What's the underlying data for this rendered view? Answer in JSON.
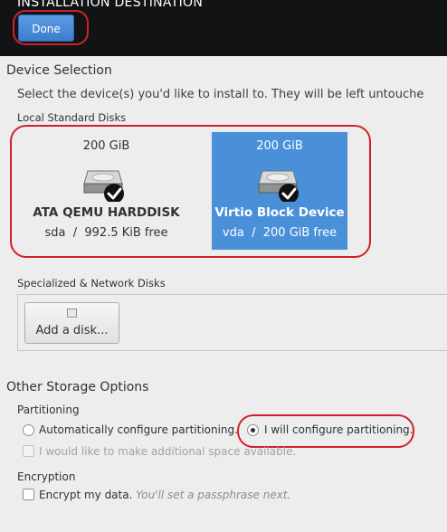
{
  "header": {
    "title": "INSTALLATION DESTINATION",
    "done_label": "Done"
  },
  "device_selection": {
    "title": "Device Selection",
    "description": "Select the device(s) you'd like to install to.  They will be left untouche",
    "local_disks_label": "Local Standard Disks",
    "disks": [
      {
        "size": "200 GiB",
        "name": "ATA QEMU HARDDISK",
        "device": "sda",
        "sep": "/",
        "free": "992.5 KiB free",
        "selected": false,
        "checked": true
      },
      {
        "size": "200 GiB",
        "name": "Virtio Block Device",
        "device": "vda",
        "sep": "/",
        "free": "200 GiB free",
        "selected": true,
        "checked": true
      }
    ],
    "network_disks_label": "Specialized & Network Disks",
    "add_disk_label": "Add a disk..."
  },
  "storage_options": {
    "title": "Other Storage Options",
    "partitioning_label": "Partitioning",
    "auto_partition_label": "Automatically configure partitioning.",
    "manual_partition_label": "I will configure partitioning.",
    "selected_partitioning": "manual",
    "extra_space_label": "I would like to make additional space available.",
    "encryption_label": "Encryption",
    "encrypt_label": "Encrypt my data.",
    "encrypt_hint": "You'll set a passphrase next."
  },
  "colors": {
    "header_bg": "#111315",
    "accent": "#4a90d9",
    "annotation": "#d0212a",
    "background": "#ededed"
  },
  "icons": [
    "harddisk-icon",
    "check-icon",
    "add-disk-icon"
  ]
}
